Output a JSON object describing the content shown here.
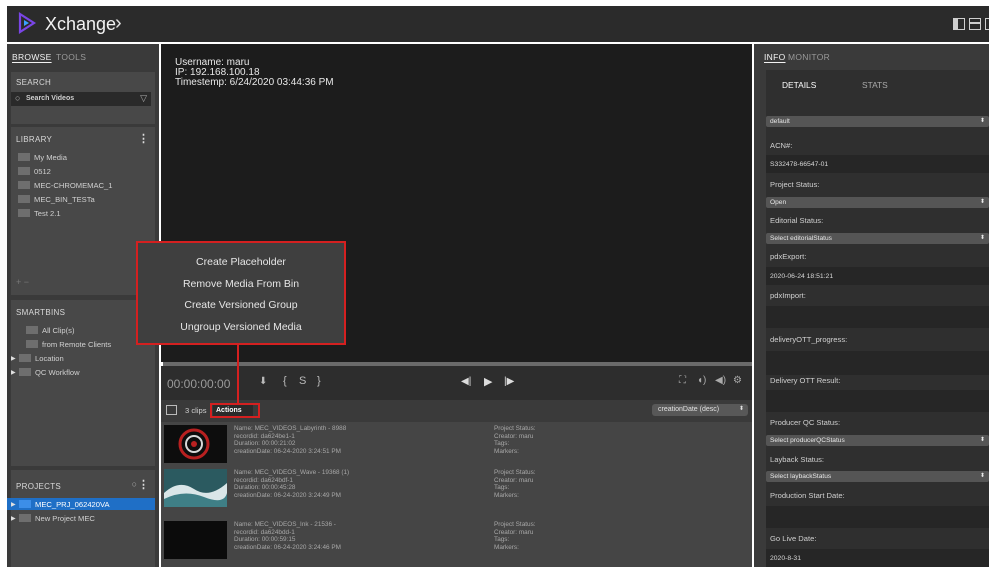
{
  "app": {
    "title": "Xchange",
    "chevron": "›",
    "brand_color": "#6b3bd8"
  },
  "left": {
    "tabs": [
      {
        "label": "BROWSE",
        "active": true
      },
      {
        "label": "TOOLS",
        "active": false
      }
    ],
    "search": {
      "title": "SEARCH",
      "placeholder": "Search Videos"
    },
    "library": {
      "title": "LIBRARY",
      "items": [
        "My Media",
        "0512",
        "MEC-CHROMEMAC_1",
        "MEC_BIN_TESTa",
        "Test 2.1"
      ],
      "add_label": "+ −"
    },
    "smartbins": {
      "title": "SMARTBINS",
      "items": [
        {
          "label": "All Clip(s)",
          "expandable": false
        },
        {
          "label": "from Remote Clients",
          "expandable": false
        },
        {
          "label": "Location",
          "expandable": true
        },
        {
          "label": "QC Workflow",
          "expandable": true
        }
      ]
    },
    "projects": {
      "title": "PROJECTS",
      "items": [
        {
          "label": "MEC_PRJ_062420VA",
          "selected": true
        },
        {
          "label": "New Project MEC",
          "selected": false
        }
      ]
    }
  },
  "player": {
    "username": "Username: maru",
    "ip": "IP: 192.168.100.18",
    "timestamp": "Timestemp: 6/24/2020 03:44:36 PM",
    "timecode": "00:00:00:00"
  },
  "context_menu": {
    "items": [
      "Create Placeholder",
      "Remove Media From Bin",
      "Create Versioned Group",
      "Ungroup Versioned Media"
    ]
  },
  "clips": {
    "count_label": "3 clips",
    "actions_label": "Actions",
    "sort_label": "creationDate (desc)",
    "rows": [
      {
        "name": "Name: MEC_VIDEOS_Labyrinth - 8988",
        "recordid": "recordid: da624be1-1",
        "duration": "Duration: 00:00:21:02",
        "creation": "creationDate: 06-24-2020 3:24:51 PM",
        "status": "Project Status:",
        "creator": "Creator: maru",
        "tags": "Tags:",
        "markers": "Markers:"
      },
      {
        "name": "Name: MEC_VIDEOS_Wave - 19368 (1)",
        "recordid": "recordid: da624bdf-1",
        "duration": "Duration: 00:00:45:28",
        "creation": "creationDate: 06-24-2020 3:24:49 PM",
        "status": "Project Status:",
        "creator": "Creator: maru",
        "tags": "Tags:",
        "markers": "Markers:"
      },
      {
        "name": "Name: MEC_VIDEOS_Ink - 21536 -",
        "recordid": "recordid: da624bdd-1",
        "duration": "Duration: 00:00:59:15",
        "creation": "creationDate: 06-24-2020 3:24:46 PM",
        "status": "Project Status:",
        "creator": "Creator: maru",
        "tags": "Tags:",
        "markers": "Markers:"
      }
    ]
  },
  "right": {
    "tabs": [
      {
        "label": "INFO",
        "active": true
      },
      {
        "label": "MONITOR",
        "active": false
      }
    ],
    "subtabs": [
      {
        "label": "DETAILS",
        "active": true
      },
      {
        "label": "STATS",
        "active": false
      }
    ],
    "template": "default",
    "acn_label": "ACN#:",
    "acn_value": "S332478-66547-01",
    "project_status_label": "Project Status:",
    "project_status_value": "Open",
    "editorial_label": "Editorial Status:",
    "editorial_value": "Select editorialStatus",
    "pdx_export_label": "pdxExport:",
    "pdx_export_value": "2020-06-24 18:51:21",
    "pdx_import_label": "pdxImport:",
    "pdx_import_value": "",
    "delivery_progress_label": "deliveryOTT_progress:",
    "delivery_progress_value": "",
    "delivery_result_label": "Delivery OTT Result:",
    "delivery_result_value": "",
    "producer_qc_label": "Producer QC Status:",
    "producer_qc_value": "Select producerQCStatus",
    "layback_label": "Layback Status:",
    "layback_value": "Select laybackStatus",
    "production_start_label": "Production Start Date:",
    "production_start_value": "",
    "go_live_label": "Go Live Date:",
    "go_live_value": "2020-8-31"
  },
  "colors": {
    "highlight": "#d42020",
    "selected_row": "#1f6fc6",
    "folder": "#6e6e6e"
  }
}
